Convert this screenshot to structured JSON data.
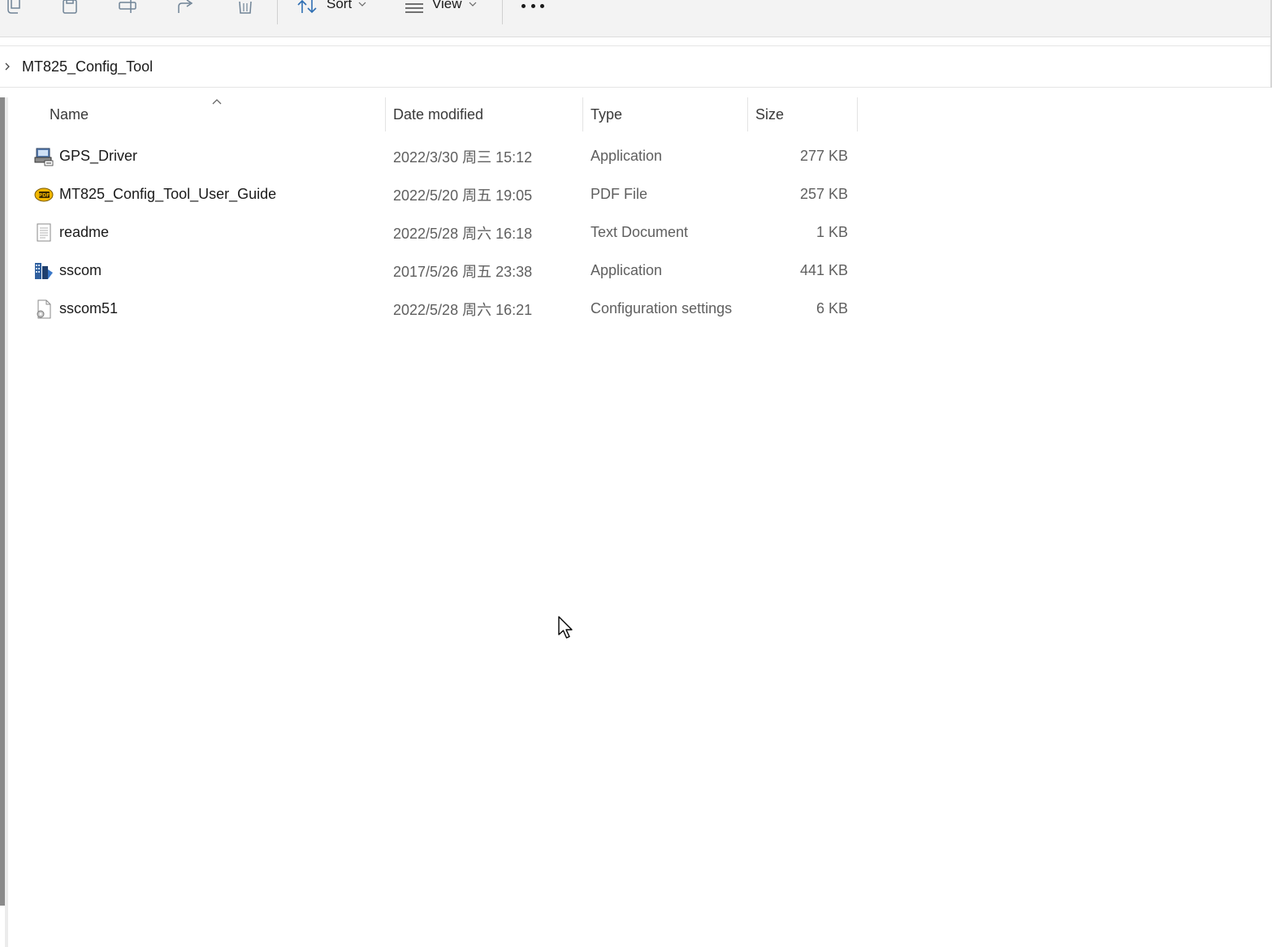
{
  "toolbar": {
    "sort_label": "Sort",
    "view_label": "View",
    "icons": [
      "copy-icon",
      "paste-icon",
      "rename-icon",
      "share-icon",
      "delete-icon",
      "sort-icon",
      "view-icon",
      "more-icon"
    ]
  },
  "address": {
    "crumb": "MT825_Config_Tool"
  },
  "columns": {
    "name": "Name",
    "date": "Date modified",
    "type": "Type",
    "size": "Size",
    "sort_indicator": "ascending"
  },
  "files": [
    {
      "name": "GPS_Driver",
      "date": "2022/3/30 周三 15:12",
      "type": "Application",
      "size": "277 KB",
      "icon": "app-installer-icon"
    },
    {
      "name": "MT825_Config_Tool_User_Guide",
      "date": "2022/5/20 周五 19:05",
      "type": "PDF File",
      "size": "257 KB",
      "icon": "pdf-icon"
    },
    {
      "name": "readme",
      "date": "2022/5/28 周六 16:18",
      "type": "Text Document",
      "size": "1 KB",
      "icon": "text-file-icon"
    },
    {
      "name": "sscom",
      "date": "2017/5/26 周五 23:38",
      "type": "Application",
      "size": "441 KB",
      "icon": "sscom-app-icon"
    },
    {
      "name": "sscom51",
      "date": "2022/5/28 周六 16:21",
      "type": "Configuration settings",
      "size": "6 KB",
      "icon": "config-file-icon"
    }
  ],
  "colors": {
    "toolbar_bg": "#f3f3f3",
    "pdf_badge": "#f2b700",
    "icon_blue": "#2f5f9e"
  }
}
